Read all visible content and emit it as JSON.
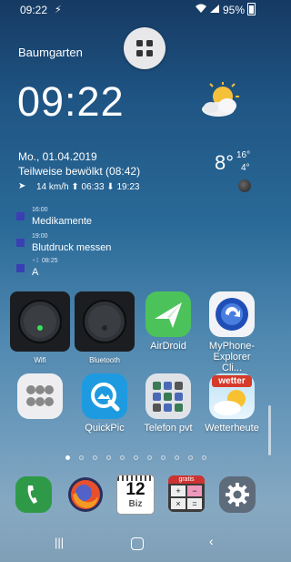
{
  "status_bar": {
    "time": "09:22",
    "battery": "95%"
  },
  "weather_widget": {
    "location": "Baumgarten",
    "clock": "09:22",
    "date": "Mo., 01.04.2019",
    "condition": "Teilweise bewölkt (08:42)",
    "wind": "14 km/h ⬆ 06:33 ⬇ 19:23",
    "temp_current": "8°",
    "temp_high": "16°",
    "temp_low": "4°"
  },
  "calendar": [
    {
      "time": "16:00",
      "title": "Medikamente"
    },
    {
      "time": "19:00",
      "title": "Blutdruck messen"
    },
    {
      "prefix": "+1",
      "time": "08:25",
      "title": "A"
    }
  ],
  "apps_row1": [
    {
      "label": "Wifi",
      "icon": "wifi-toggle-icon"
    },
    {
      "label": "Bluetooth",
      "icon": "bluetooth-toggle-icon"
    },
    {
      "label": "AirDroid",
      "icon": "airdroid-icon"
    },
    {
      "label": "MyPhone-Explorer Cli...",
      "icon": "myphoneexplorer-icon"
    }
  ],
  "apps_row2": [
    {
      "label": "",
      "icon": "folder-icon"
    },
    {
      "label": "QuickPic",
      "icon": "quickpic-icon"
    },
    {
      "label": "Telefon pvt",
      "icon": "contacts-folder-icon"
    },
    {
      "label": "Wetterheute",
      "icon": "wetter-icon"
    }
  ],
  "wetter_badge": "wetter",
  "calendar_icon": {
    "day": "12",
    "tag": "Biz"
  },
  "calculator_badge": "gratis",
  "page_indicator": {
    "count": 11,
    "active": 1
  },
  "dock": [
    {
      "icon": "phone-icon"
    },
    {
      "icon": "firefox-icon"
    },
    {
      "icon": "calendar-biz-icon"
    },
    {
      "icon": "calculator-icon"
    },
    {
      "icon": "settings-icon"
    }
  ],
  "colors": {
    "event_marker": "#3a3fb3",
    "airdroid": "#4cc35a",
    "phone": "#2e9a47"
  }
}
